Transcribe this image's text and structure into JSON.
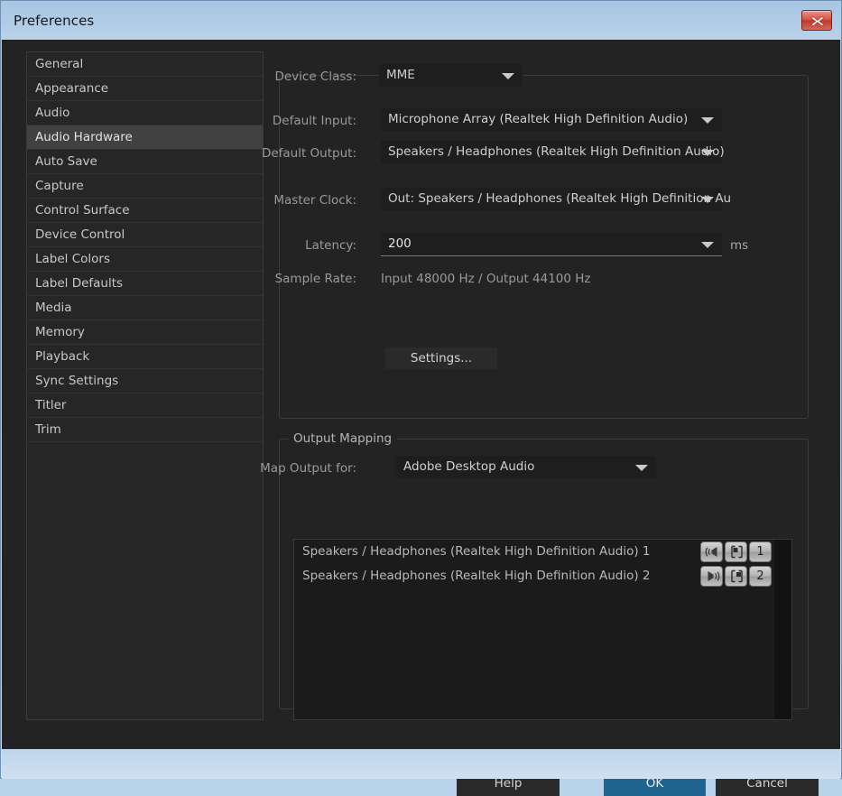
{
  "window": {
    "title": "Preferences",
    "close_icon": "close-x-icon"
  },
  "sidebar": {
    "items": [
      {
        "label": "General",
        "selected": false
      },
      {
        "label": "Appearance",
        "selected": false
      },
      {
        "label": "Audio",
        "selected": false
      },
      {
        "label": "Audio Hardware",
        "selected": true
      },
      {
        "label": "Auto Save",
        "selected": false
      },
      {
        "label": "Capture",
        "selected": false
      },
      {
        "label": "Control Surface",
        "selected": false
      },
      {
        "label": "Device Control",
        "selected": false
      },
      {
        "label": "Label Colors",
        "selected": false
      },
      {
        "label": "Label Defaults",
        "selected": false
      },
      {
        "label": "Media",
        "selected": false
      },
      {
        "label": "Memory",
        "selected": false
      },
      {
        "label": "Playback",
        "selected": false
      },
      {
        "label": "Sync Settings",
        "selected": false
      },
      {
        "label": "Titler",
        "selected": false
      },
      {
        "label": "Trim",
        "selected": false
      }
    ]
  },
  "device_settings": {
    "device_class": {
      "label": "Device Class:",
      "value": "MME"
    },
    "default_input": {
      "label": "Default Input:",
      "value": "Microphone Array (Realtek High Definition Audio)"
    },
    "default_output": {
      "label": "Default Output:",
      "value": "Speakers / Headphones (Realtek High Definition Audio)"
    },
    "master_clock": {
      "label": "Master Clock:",
      "value": "Out: Speakers / Headphones (Realtek High Definition Au"
    },
    "latency": {
      "label": "Latency:",
      "value": "200",
      "unit": "ms"
    },
    "sample_rate": {
      "label": "Sample Rate:",
      "value": "Input 48000 Hz / Output 44100 Hz"
    },
    "settings_button": "Settings..."
  },
  "output_mapping": {
    "title": "Output Mapping",
    "map_output_for": {
      "label": "Map Output for:",
      "value": "Adobe Desktop Audio"
    },
    "rows": [
      {
        "label": "Speakers / Headphones (Realtek High Definition Audio) 1",
        "channel_icon": "speaker-left-icon",
        "pan_icon": "stereo-bracket-icon",
        "number": "1"
      },
      {
        "label": "Speakers / Headphones (Realtek High Definition Audio) 2",
        "channel_icon": "speaker-right-icon",
        "pan_icon": "stereo-bracket-icon",
        "number": "2"
      }
    ]
  },
  "footer": {
    "help": "Help",
    "ok": "OK",
    "cancel": "Cancel"
  },
  "colors": {
    "accent": "#1e648f",
    "focus_underline": "#2f93d1",
    "window_chrome": "#b2cce6",
    "close_red": "#c0392c",
    "dialog_bg": "#232323"
  }
}
